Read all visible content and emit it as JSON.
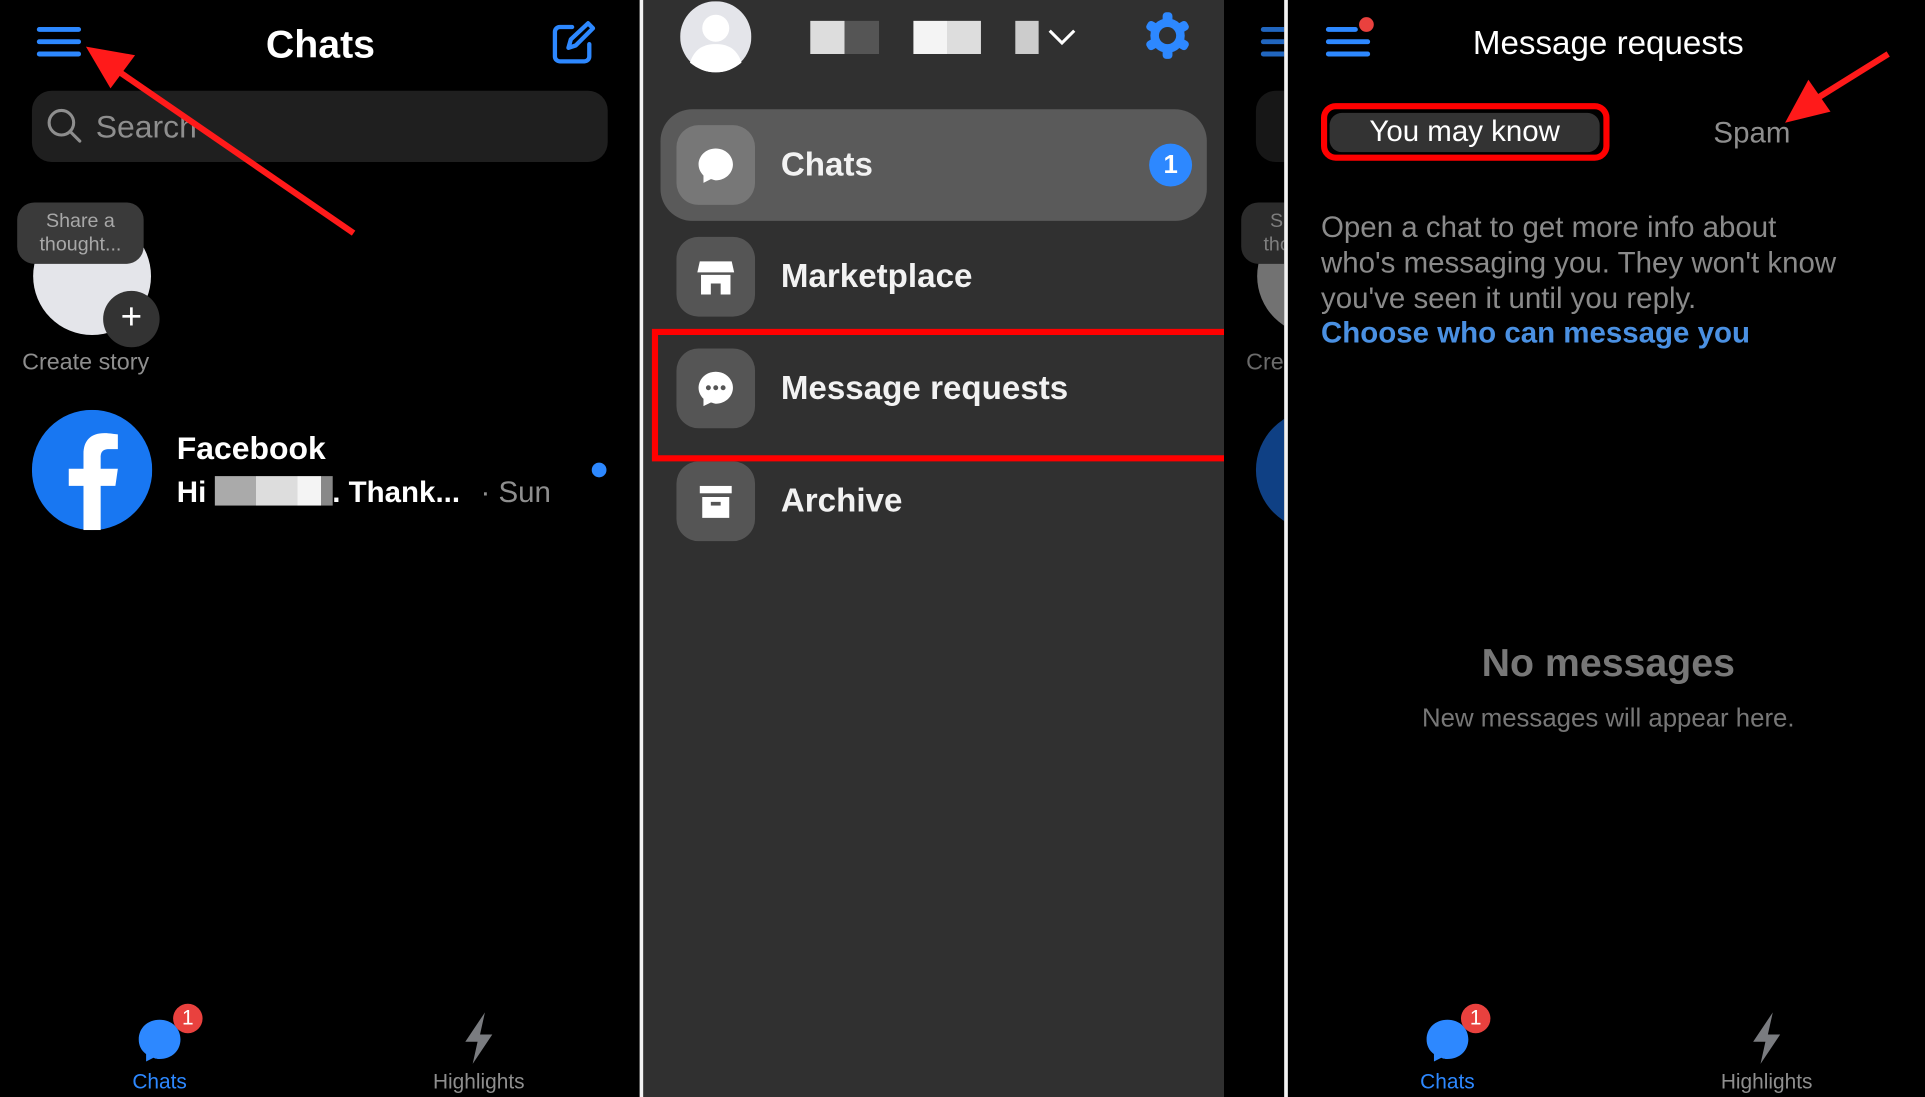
{
  "left_panel": {
    "title": "Chats",
    "search_placeholder": "Search",
    "story_bubble": "Share a thought...",
    "create_story": "Create story",
    "chat": {
      "name": "Facebook",
      "preview_start": "Hi",
      "preview_end": ". Thank...",
      "time": "· Sun",
      "unread": true
    },
    "bottom_nav": [
      {
        "label": "Chats",
        "badge": "1",
        "active": true
      },
      {
        "label": "Highlights"
      }
    ]
  },
  "menu_panel": {
    "items": [
      {
        "label": "Chats",
        "icon": "chat-bubble-icon",
        "badge": "1",
        "selected": true
      },
      {
        "label": "Marketplace",
        "icon": "storefront-icon"
      },
      {
        "label": "Message requests",
        "icon": "chat-dots-icon",
        "highlighted": true
      },
      {
        "label": "Archive",
        "icon": "archive-box-icon"
      }
    ]
  },
  "requests_panel": {
    "title": "Message requests",
    "tabs": [
      {
        "label": "You may know",
        "active": true
      },
      {
        "label": "Spam"
      }
    ],
    "info": "Open a chat to get more info about who's messaging you. They won't know you've seen it until you reply.",
    "link": "Choose who can message you",
    "empty_title": "No messages",
    "empty_subtitle": "New messages will appear here.",
    "bottom_nav": [
      {
        "label": "Chats",
        "badge": "1",
        "active": true
      },
      {
        "label": "Highlights"
      }
    ]
  },
  "colors": {
    "accent": "#2d88ff",
    "annotation": "#ff0000",
    "badge": "#e9413e",
    "menu_bg": "#303030"
  }
}
